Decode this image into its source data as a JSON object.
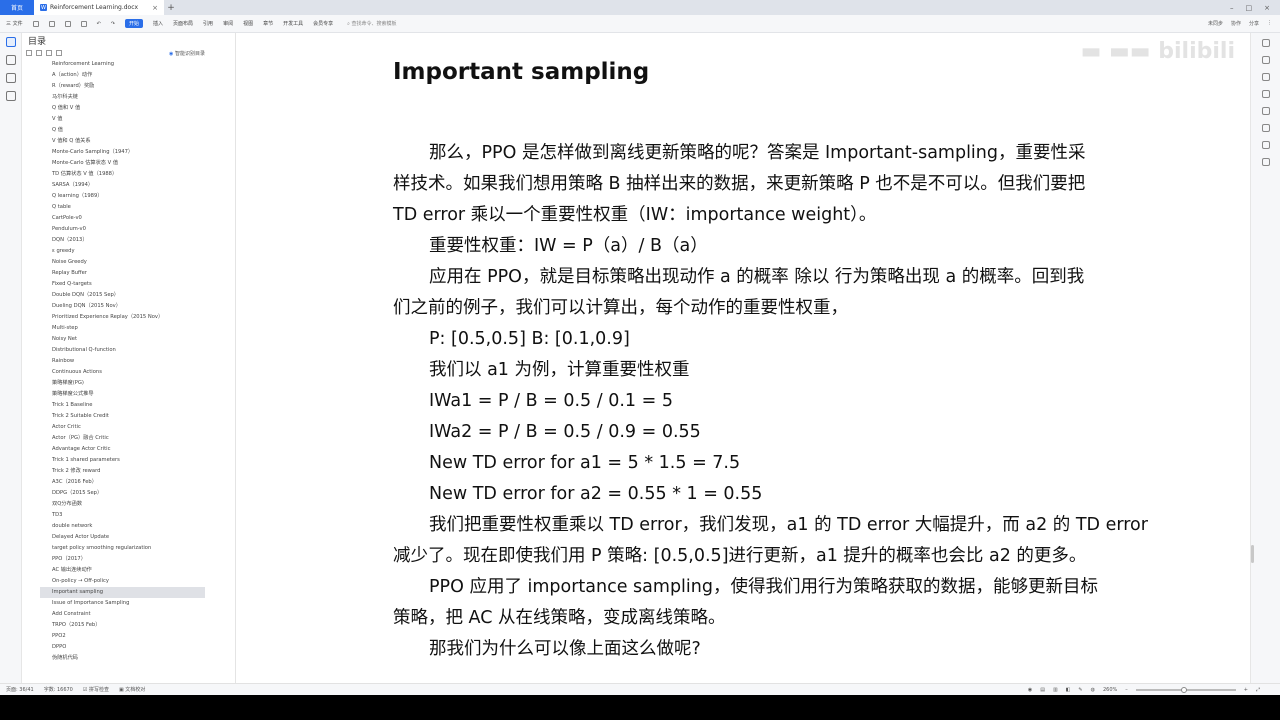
{
  "tabs": {
    "home_label": "首页",
    "doc_label": "Reinforcement Learning.docx",
    "doc_icon": "W"
  },
  "menu": {
    "file": "三 文件",
    "items": [
      "开始",
      "插入",
      "页面布局",
      "引用",
      "审阅",
      "视图",
      "章节",
      "开发工具",
      "会员专享"
    ],
    "active_index": 0,
    "search_placeholder": "查找命令、搜索模板",
    "right": [
      "未同步",
      "协作",
      "分享"
    ]
  },
  "toc": {
    "title": "目录",
    "smart_label": "智能识别目录",
    "items": [
      "Reinforcement Learning",
      "A（action）动作",
      "R（reward）奖励",
      "马尔科夫链",
      "Q 值和 V 值",
      "V 值",
      "Q 值",
      "V 值和 Q 值关系",
      "Monte-Carlo Sampling（1947）",
      "Monte-Carlo 估算状态 V 值",
      "TD 估算状态 V 值（1988）",
      "SARSA（1994）",
      "Q learning（1989）",
      "Q table",
      "CartPole-v0",
      "Pendulum-v0",
      "DQN（2013）",
      "ε greedy",
      "Noise Greedy",
      "Replay Buffer",
      "Fixed Q-targets",
      "Double DQN（2015 Sep）",
      "Dueling DQN（2015 Nov）",
      "Prioritized Experience Replay（2015 Nov）",
      "Multi-step",
      "Noisy Net",
      "Distributional Q-function",
      "Rainbow",
      "Continuous Actions",
      "策略梯度(PG)",
      "策略梯度公式推导",
      "Trick 1 Baseline",
      "Trick 2 Suitable Credit",
      "Actor Critic",
      "Actor（PG）融合 Critic",
      "Advantage Actor Critic",
      "Trick 1 shared parameters",
      "Trick 2 修改 reward",
      "A3C（2016 Feb）",
      "DDPG（2015 Sep）",
      "双Q分布函数",
      "TD3",
      "double network",
      "Delayed Actor Update",
      "target policy smoothing regularization",
      "PPO（2017）",
      "AC 输出连续动作",
      "On-policy → Off-policy",
      "Important sampling",
      "Issue of Importance Sampling",
      "Add Constraint",
      "TRPO（2015 Feb）",
      "PPO2",
      "DPPO",
      "伪随机代码"
    ],
    "active_index": 48
  },
  "doc": {
    "title": "Important sampling",
    "lines": [
      {
        "text": "那么，PPO 是怎样做到离线更新策略的呢？答案是 Important-sampling，重要性采",
        "indent": true
      },
      {
        "text": "样技术。如果我们想用策略 B 抽样出来的数据，来更新策略 P 也不是不可以。但我们要把",
        "indent": false
      },
      {
        "text": "TD error 乘以一个重要性权重（IW：importance weight）。",
        "indent": false
      },
      {
        "text": "重要性权重：IW = P（a）/ B（a）",
        "indent": true
      },
      {
        "text": "应用在 PPO，就是目标策略出现动作 a 的概率  除以  行为策略出现 a 的概率。回到我",
        "indent": true
      },
      {
        "text": "们之前的例子，我们可以计算出，每个动作的重要性权重，",
        "indent": false
      },
      {
        "text": "P: [0.5,0.5]  B: [0.1,0.9]",
        "indent": true
      },
      {
        "text": "我们以 a1 为例，计算重要性权重",
        "indent": true
      },
      {
        "text": "IWa1 = P / B = 0.5 / 0.1 = 5",
        "indent": true
      },
      {
        "text": "IWa2 = P / B = 0.5 / 0.9 = 0.55",
        "indent": true
      },
      {
        "text": "New TD error for a1 = 5 * 1.5 = 7.5",
        "indent": true
      },
      {
        "text": "New TD error for a2 = 0.55 * 1 = 0.55",
        "indent": true
      },
      {
        "text": "我们把重要性权重乘以 TD error，我们发现，a1 的 TD error 大幅提升，而 a2 的 TD error",
        "indent": true
      },
      {
        "text": "减少了。现在即使我们用 P 策略: [0.5,0.5]进行更新，a1 提升的概率也会比 a2 的更多。",
        "indent": false
      },
      {
        "text": "PPO 应用了 importance sampling，使得我们用行为策略获取的数据，能够更新目标",
        "indent": true
      },
      {
        "text": "策略，把 AC 从在线策略，变成离线策略。",
        "indent": false
      },
      {
        "text": "那我们为什么可以像上面这么做呢?",
        "indent": true
      }
    ]
  },
  "status": {
    "page": "页面: 36/41",
    "words": "字数: 16670",
    "spell": "拼写检查",
    "proof": "文档校对",
    "zoom": "260%"
  },
  "colors": {
    "accent": "#2a6ee8",
    "toc_active_bg": "#dfe1e6"
  }
}
